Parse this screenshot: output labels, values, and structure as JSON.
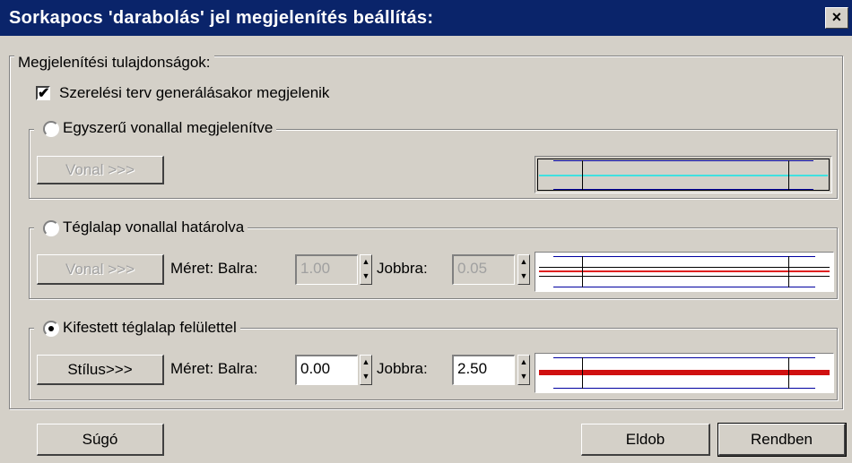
{
  "window": {
    "title": "Sorkapocs 'darabolás' jel megjelenítés beállítás:",
    "close_glyph": "×"
  },
  "properties": {
    "legend": "Megjelenítési tulajdonságok:",
    "show_checkbox": {
      "label": "Szerelési terv generálásakor megjelenik",
      "checked": true
    }
  },
  "simple_line": {
    "radio_label": "Egyszerű vonallal megjelenítve",
    "selected": false,
    "line_button": "Vonal >>>",
    "preview_line_color": "#40e0e0"
  },
  "rect_line": {
    "radio_label": "Téglalap vonallal határolva",
    "selected": false,
    "line_button": "Vonal >>>",
    "size_label": "Méret: Balra:",
    "left_value": "1.00",
    "right_label": "Jobbra:",
    "right_value": "0.05",
    "preview_line_color": "#e02020"
  },
  "filled_rect": {
    "radio_label": "Kifestett téglalap felülettel",
    "selected": true,
    "style_button": "Stílus>>>",
    "size_label": "Méret: Balra:",
    "left_value": "0.00",
    "right_label": "Jobbra:",
    "right_value": "2.50",
    "preview_line_color": "#d01010"
  },
  "footer": {
    "help_button": "Súgó",
    "discard_button": "Eldob",
    "ok_button": "Rendben"
  }
}
